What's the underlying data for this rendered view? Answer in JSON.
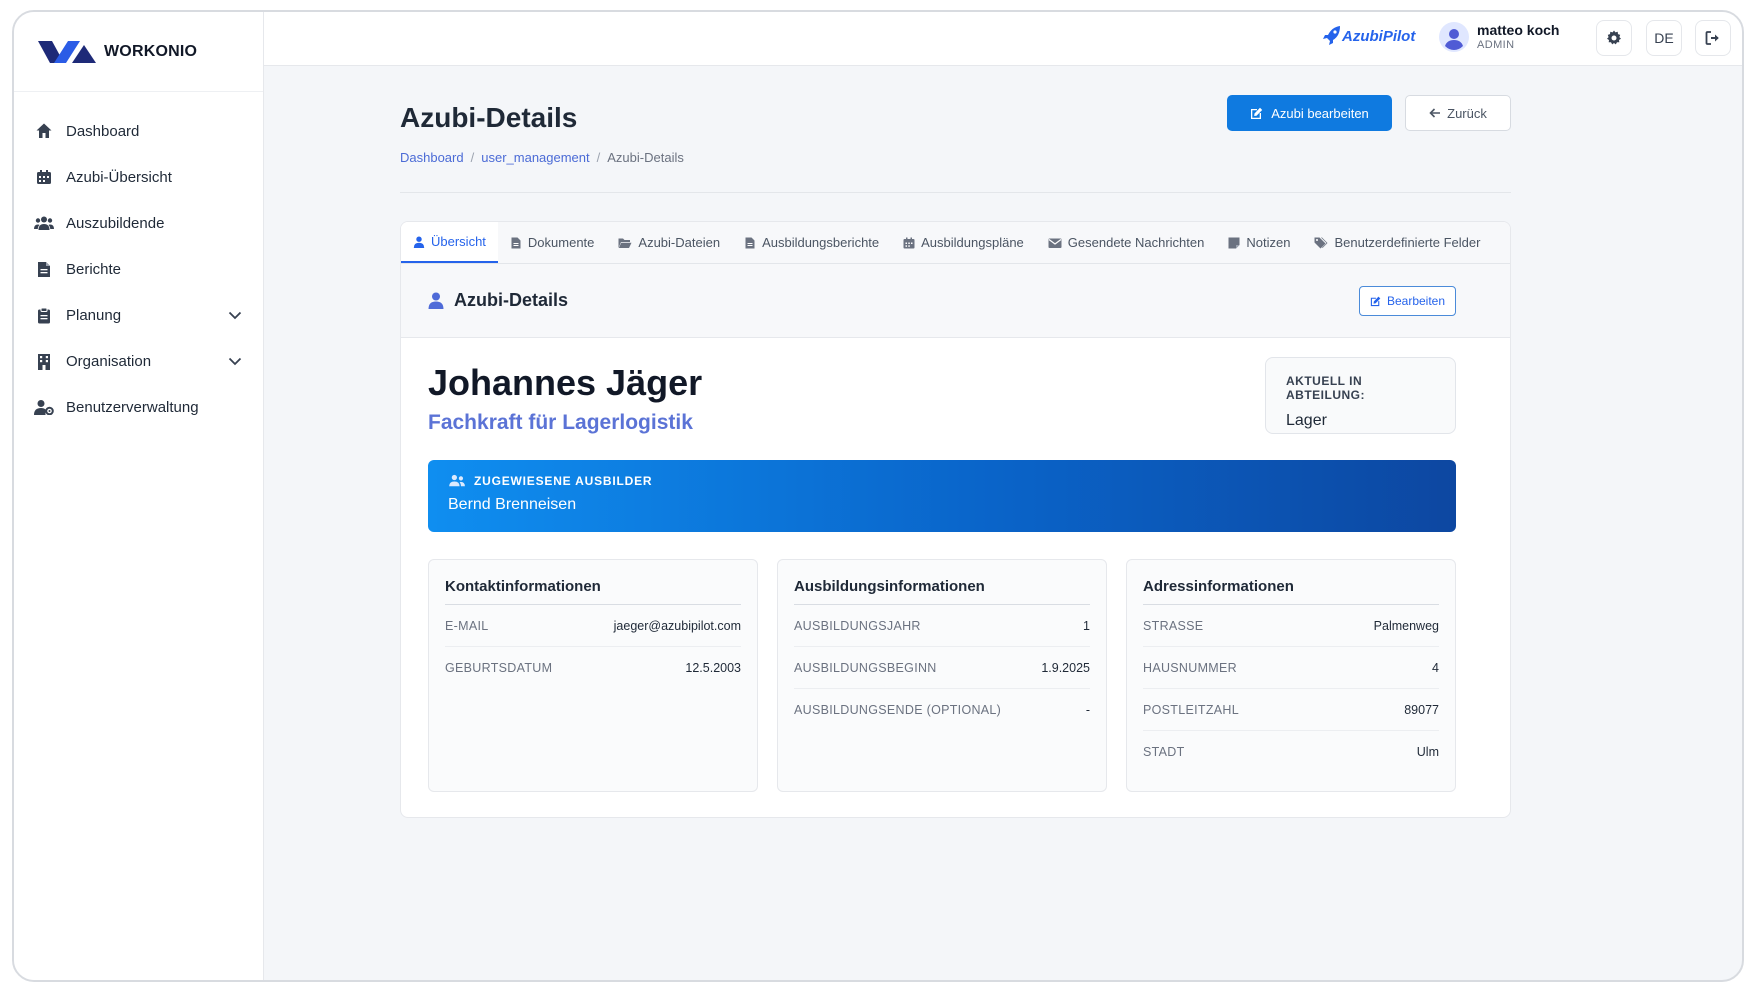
{
  "app": {
    "logo_text": "WORKONIO",
    "brand": "AzubiPilot"
  },
  "sidebar": {
    "items": [
      {
        "label": "Dashboard",
        "icon": "home-icon"
      },
      {
        "label": "Azubi-Übersicht",
        "icon": "calendar-icon"
      },
      {
        "label": "Auszubildende",
        "icon": "users-icon"
      },
      {
        "label": "Berichte",
        "icon": "file-icon"
      },
      {
        "label": "Planung",
        "icon": "clipboard-icon",
        "expandable": true
      },
      {
        "label": "Organisation",
        "icon": "building-icon",
        "expandable": true
      },
      {
        "label": "Benutzerverwaltung",
        "icon": "user-gear-icon"
      }
    ]
  },
  "header": {
    "user_name": "matteo koch",
    "user_role": "ADMIN",
    "language": "DE"
  },
  "page": {
    "title": "Azubi-Details",
    "breadcrumb": [
      "Dashboard",
      "user_management",
      "Azubi-Details"
    ],
    "edit_button": "Azubi bearbeiten",
    "back_button": "Zurück"
  },
  "tabs": [
    {
      "label": "Übersicht",
      "icon": "user-icon",
      "active": true
    },
    {
      "label": "Dokumente",
      "icon": "file-icon"
    },
    {
      "label": "Azubi-Dateien",
      "icon": "folder-open-icon"
    },
    {
      "label": "Ausbildungsberichte",
      "icon": "file-icon"
    },
    {
      "label": "Ausbildungspläne",
      "icon": "calendar-icon"
    },
    {
      "label": "Gesendete Nachrichten",
      "icon": "envelope-icon"
    },
    {
      "label": "Notizen",
      "icon": "note-icon"
    },
    {
      "label": "Benutzerdefinierte Felder",
      "icon": "tags-icon"
    }
  ],
  "details": {
    "section_title": "Azubi-Details",
    "edit_label": "Bearbeiten",
    "name": "Johannes Jäger",
    "profession": "Fachkraft für Lagerlogistik",
    "department_label": "AKTUELL IN ABTEILUNG:",
    "department_value": "Lager",
    "trainer_label": "ZUGEWIESENE AUSBILDER",
    "trainer_name": "Bernd Brenneisen"
  },
  "contact": {
    "title": "Kontaktinformationen",
    "rows": [
      {
        "key": "E-MAIL",
        "value": "jaeger@azubipilot.com"
      },
      {
        "key": "GEBURTSDATUM",
        "value": "12.5.2003"
      }
    ]
  },
  "training": {
    "title": "Ausbildungsinformationen",
    "rows": [
      {
        "key": "AUSBILDUNGSJAHR",
        "value": "1"
      },
      {
        "key": "AUSBILDUNGSBEGINN",
        "value": "1.9.2025"
      },
      {
        "key": "AUSBILDUNGSENDE (OPTIONAL)",
        "value": "-"
      }
    ]
  },
  "address": {
    "title": "Adressinformationen",
    "rows": [
      {
        "key": "STRASSE",
        "value": "Palmenweg"
      },
      {
        "key": "HAUSNUMMER",
        "value": "4"
      },
      {
        "key": "POSTLEITZAHL",
        "value": "89077"
      },
      {
        "key": "STADT",
        "value": "Ulm"
      }
    ]
  },
  "colors": {
    "primary": "#0f7ae0",
    "link": "#4b6bd6",
    "accent": "#2563eb"
  }
}
